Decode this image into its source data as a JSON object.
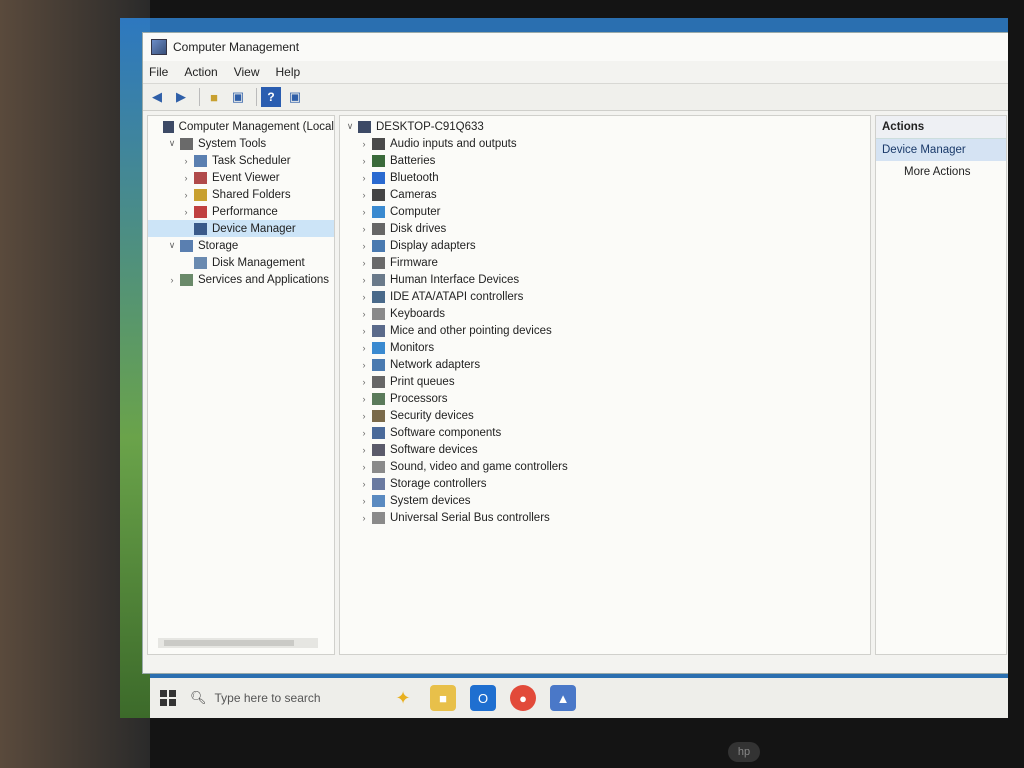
{
  "window": {
    "title": "Computer Management"
  },
  "menu": [
    "File",
    "Action",
    "View",
    "Help"
  ],
  "tree": [
    {
      "label": "Computer Management (Local",
      "level": 0,
      "chevron": "",
      "icon": "computer-management-icon"
    },
    {
      "label": "System Tools",
      "level": 1,
      "chevron": "v",
      "icon": "system-tools-icon"
    },
    {
      "label": "Task Scheduler",
      "level": 2,
      "chevron": ">",
      "icon": "task-scheduler-icon"
    },
    {
      "label": "Event Viewer",
      "level": 2,
      "chevron": ">",
      "icon": "event-viewer-icon"
    },
    {
      "label": "Shared Folders",
      "level": 2,
      "chevron": ">",
      "icon": "shared-folders-icon"
    },
    {
      "label": "Performance",
      "level": 2,
      "chevron": ">",
      "icon": "performance-icon"
    },
    {
      "label": "Device Manager",
      "level": 2,
      "chevron": "",
      "icon": "device-manager-icon",
      "selected": true
    },
    {
      "label": "Storage",
      "level": 1,
      "chevron": "v",
      "icon": "storage-icon"
    },
    {
      "label": "Disk Management",
      "level": 2,
      "chevron": "",
      "icon": "disk-management-icon"
    },
    {
      "label": "Services and Applications",
      "level": 1,
      "chevron": ">",
      "icon": "services-icon"
    }
  ],
  "devices": {
    "root": "DESKTOP-C91Q633",
    "categories": [
      "Audio inputs and outputs",
      "Batteries",
      "Bluetooth",
      "Cameras",
      "Computer",
      "Disk drives",
      "Display adapters",
      "Firmware",
      "Human Interface Devices",
      "IDE ATA/ATAPI controllers",
      "Keyboards",
      "Mice and other pointing devices",
      "Monitors",
      "Network adapters",
      "Print queues",
      "Processors",
      "Security devices",
      "Software components",
      "Software devices",
      "Sound, video and game controllers",
      "Storage controllers",
      "System devices",
      "Universal Serial Bus controllers"
    ]
  },
  "actions": {
    "header": "Actions",
    "section": "Device Manager",
    "more": "More Actions"
  },
  "taskbar": {
    "search_placeholder": "Type here to search"
  },
  "colors": {
    "selection": "#cce4f7",
    "accent": "#2a5db0"
  }
}
